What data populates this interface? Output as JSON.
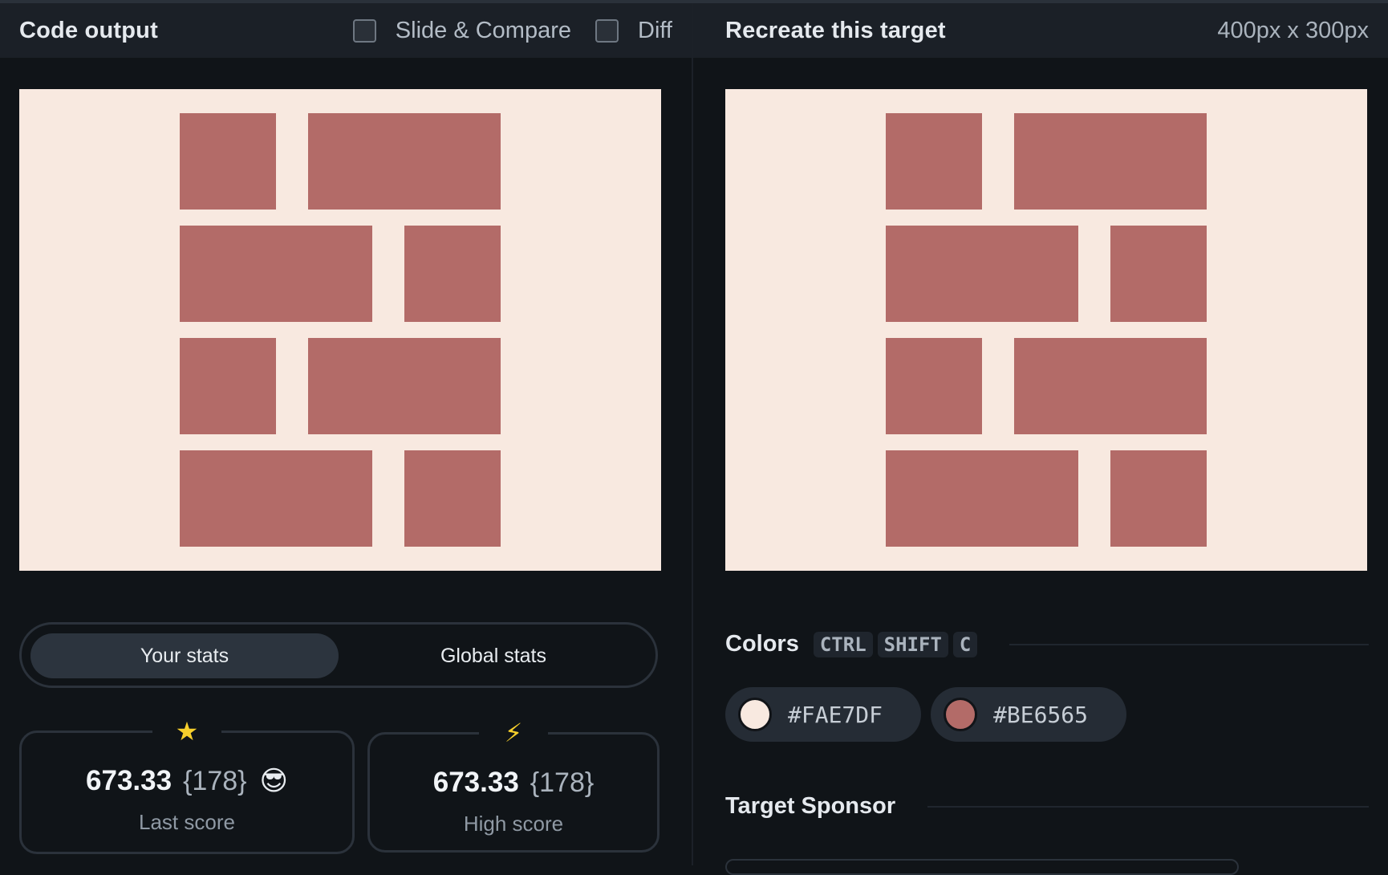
{
  "left_panel": {
    "title": "Code output",
    "checkboxes": [
      {
        "label": "Slide & Compare",
        "checked": false
      },
      {
        "label": "Diff",
        "checked": false
      }
    ]
  },
  "right_panel": {
    "title": "Recreate this target",
    "dimensions": "400px x 300px"
  },
  "stats_toggle": {
    "options": [
      "Your stats",
      "Global stats"
    ],
    "selected": "Your stats"
  },
  "stats": {
    "last": {
      "score": "673.33",
      "count": "{178}",
      "label": "Last score",
      "icon": "star-icon",
      "emoji": "sunglasses-emoji"
    },
    "high": {
      "score": "673.33",
      "count": "{178}",
      "label": "High score",
      "icon": "lightning-bolt-icon"
    }
  },
  "colors_section": {
    "title": "Colors",
    "shortcut": [
      "CTRL",
      "SHIFT",
      "C"
    ],
    "swatches": [
      {
        "hex": "#FAE7DF",
        "color": "#f8e9e0"
      },
      {
        "hex": "#BE6565",
        "color": "#b36b68"
      }
    ]
  },
  "sponsor_section": {
    "title": "Target Sponsor"
  },
  "canvas_colors": {
    "background": "#f8e9e0",
    "brick": "#b36b68"
  }
}
